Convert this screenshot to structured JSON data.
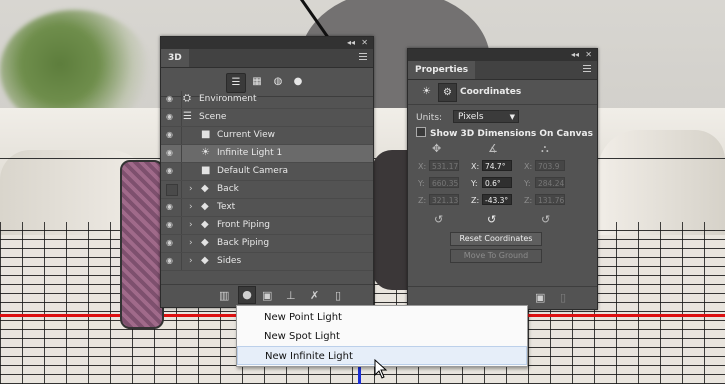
{
  "panel3d": {
    "tab": "3D",
    "filter_icons": [
      "whole-scene-icon",
      "meshes-icon",
      "materials-icon",
      "lights-icon"
    ],
    "rows": [
      {
        "label": "Environment",
        "icon": "environment-icon",
        "visible": true,
        "expandable": false,
        "indent": 0,
        "selected": false
      },
      {
        "label": "Scene",
        "icon": "scene-icon",
        "visible": true,
        "expandable": false,
        "indent": 0,
        "selected": false
      },
      {
        "label": "Current View",
        "icon": "camera-icon",
        "visible": true,
        "expandable": false,
        "indent": 1,
        "selected": false
      },
      {
        "label": "Infinite Light 1",
        "icon": "infinite-light-icon",
        "visible": true,
        "expandable": false,
        "indent": 1,
        "selected": true
      },
      {
        "label": "Default Camera",
        "icon": "camera-icon",
        "visible": true,
        "expandable": false,
        "indent": 1,
        "selected": false
      },
      {
        "label": "Back",
        "icon": "mesh-icon",
        "visible": false,
        "expandable": true,
        "indent": 1,
        "selected": false
      },
      {
        "label": "Text",
        "icon": "mesh-icon",
        "visible": true,
        "expandable": true,
        "indent": 1,
        "selected": false
      },
      {
        "label": "Front Piping",
        "icon": "mesh-icon",
        "visible": true,
        "expandable": true,
        "indent": 1,
        "selected": false
      },
      {
        "label": "Back Piping",
        "icon": "mesh-icon",
        "visible": true,
        "expandable": true,
        "indent": 1,
        "selected": false
      },
      {
        "label": "Sides",
        "icon": "mesh-icon",
        "visible": true,
        "expandable": true,
        "indent": 1,
        "selected": false
      }
    ],
    "bottom_icons": [
      "render-icon",
      "add-light-icon",
      "new-object-icon",
      "drop-to-ground-icon",
      "delete-light-icon",
      "delete-icon"
    ]
  },
  "properties": {
    "tab": "Properties",
    "section_title": "Coordinates",
    "units_label": "Units:",
    "units_value": "Pixels",
    "show_dims_label": "Show 3D Dimensions On Canvas",
    "position": {
      "x": "531.17",
      "y": "660.35",
      "z": "321.13"
    },
    "rotation": {
      "x": "74.7°",
      "y": "0.6°",
      "z": "-43.3°"
    },
    "scale": {
      "x": "703.9",
      "y": "284.24",
      "z": "131.76"
    },
    "axis_labels": {
      "x": "X:",
      "y": "Y:",
      "z": "Z:"
    },
    "reset_button": "Reset Coordinates",
    "move_button": "Move To Ground"
  },
  "menu": {
    "items": [
      "New Point Light",
      "New Spot Light",
      "New Infinite Light"
    ],
    "highlighted": 2
  },
  "colors": {
    "panel_bg": "#535353",
    "selected_row": "#6a6a6a",
    "menu_highlight": "#e6eef9",
    "ground_line": "#dd1111",
    "axis_blue": "#1a2ed8"
  }
}
